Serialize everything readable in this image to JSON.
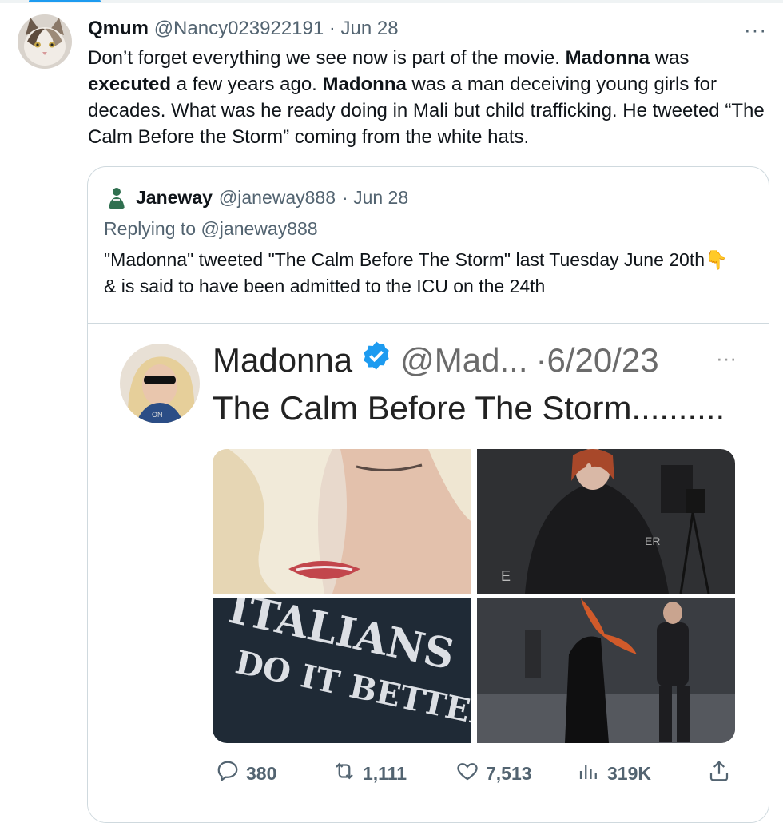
{
  "tweet": {
    "display_name": "Qmum",
    "handle": "@Nancy023922191",
    "date": "· Jun 28",
    "more_label": "···",
    "text_parts": [
      "Don’t forget everything we see now is part of the movie. ",
      "Madonna",
      " was ",
      "executed",
      " a few years ago. ",
      "Madonna",
      " was a man deceiving young girls for decades. What was he ready doing in Mali but child trafficking. He tweeted “The Calm Before the Storm” coming from the white hats."
    ]
  },
  "quote": {
    "display_name": "Janeway",
    "handle": "@janeway888",
    "date": "· Jun 28",
    "reply_label": "Replying to @janeway888",
    "text_a": "\"Madonna\" tweeted \"The Calm Before The Storm\" last Tuesday June 20th",
    "emoji": "👇",
    "text_b": " & is said to have been admitted to the ICU on the 24th",
    "screenshot": {
      "name": "Madonna",
      "handle": "@Mad...",
      "date": "·6/20/23",
      "more_label": "···",
      "text": "The Calm Before The Storm..........",
      "photo_text_line1": "ITALIANS",
      "photo_text_line2": "DO IT BETTER"
    },
    "stats": {
      "replies": "380",
      "retweets": "1,111",
      "likes": "7,513",
      "views": "319K"
    }
  },
  "colors": {
    "text": "#0f1419",
    "muted": "#536471",
    "border": "#cfd9de",
    "verified": "#1d9bf0"
  },
  "icons": [
    "cat-avatar",
    "janeway-avatar",
    "verified-badge-icon",
    "reply-icon",
    "retweet-icon",
    "like-icon",
    "views-icon",
    "share-icon",
    "more-icon"
  ]
}
